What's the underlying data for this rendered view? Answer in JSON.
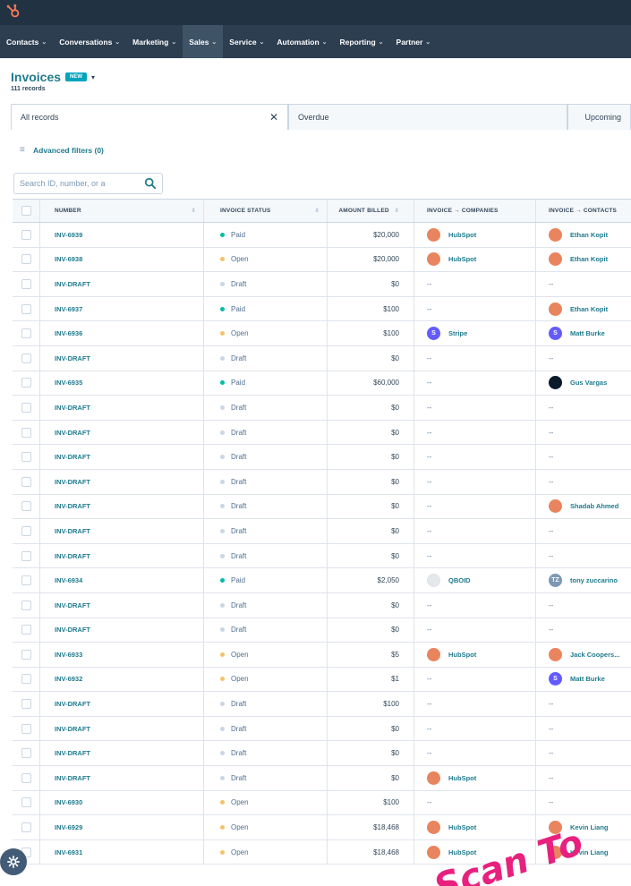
{
  "nav": {
    "items": [
      {
        "label": "Contacts",
        "active": false
      },
      {
        "label": "Conversations",
        "active": false
      },
      {
        "label": "Marketing",
        "active": false
      },
      {
        "label": "Sales",
        "active": true
      },
      {
        "label": "Service",
        "active": false
      },
      {
        "label": "Automation",
        "active": false
      },
      {
        "label": "Reporting",
        "active": false
      },
      {
        "label": "Partner",
        "active": false
      }
    ]
  },
  "header": {
    "title": "Invoices",
    "badge": "NEW",
    "count": "111 records"
  },
  "tabs": {
    "all_records": "All records",
    "overdue": "Overdue",
    "upcoming": "Upcoming"
  },
  "filters": {
    "label": "Advanced filters (0)"
  },
  "search": {
    "placeholder": "Search ID, number, or a"
  },
  "table": {
    "columns": {
      "number": "NUMBER",
      "status": "INVOICE STATUS",
      "amount": "AMOUNT BILLED",
      "companies": "INVOICE → COMPANIES",
      "contacts": "INVOICE → CONTACTS"
    },
    "rows": [
      {
        "number": "INV-6939",
        "status": "Paid",
        "amount": "$20,000",
        "company": "HubSpot",
        "contact": "Ethan Kopit"
      },
      {
        "number": "INV-6938",
        "status": "Open",
        "amount": "$20,000",
        "company": "HubSpot",
        "contact": "Ethan Kopit"
      },
      {
        "number": "INV-DRAFT",
        "status": "Draft",
        "amount": "$0",
        "company": "--",
        "contact": "--"
      },
      {
        "number": "INV-6937",
        "status": "Paid",
        "amount": "$100",
        "company": "--",
        "contact": "Ethan Kopit"
      },
      {
        "number": "INV-6936",
        "status": "Open",
        "amount": "$100",
        "company": "Stripe",
        "contact": "Matt Burke"
      },
      {
        "number": "INV-DRAFT",
        "status": "Draft",
        "amount": "$0",
        "company": "--",
        "contact": "--"
      },
      {
        "number": "INV-6935",
        "status": "Paid",
        "amount": "$60,000",
        "company": "--",
        "contact": "Gus Vargas"
      },
      {
        "number": "INV-DRAFT",
        "status": "Draft",
        "amount": "$0",
        "company": "--",
        "contact": "--"
      },
      {
        "number": "INV-DRAFT",
        "status": "Draft",
        "amount": "$0",
        "company": "--",
        "contact": "--"
      },
      {
        "number": "INV-DRAFT",
        "status": "Draft",
        "amount": "$0",
        "company": "--",
        "contact": "--"
      },
      {
        "number": "INV-DRAFT",
        "status": "Draft",
        "amount": "$0",
        "company": "--",
        "contact": "--"
      },
      {
        "number": "INV-DRAFT",
        "status": "Draft",
        "amount": "$0",
        "company": "--",
        "contact": "Shadab Ahmed"
      },
      {
        "number": "INV-DRAFT",
        "status": "Draft",
        "amount": "$0",
        "company": "--",
        "contact": "--"
      },
      {
        "number": "INV-DRAFT",
        "status": "Draft",
        "amount": "$0",
        "company": "--",
        "contact": "--"
      },
      {
        "number": "INV-6934",
        "status": "Paid",
        "amount": "$2,050",
        "company": "QBOID",
        "contact": "tony zuccarino"
      },
      {
        "number": "INV-DRAFT",
        "status": "Draft",
        "amount": "$0",
        "company": "--",
        "contact": "--"
      },
      {
        "number": "INV-DRAFT",
        "status": "Draft",
        "amount": "$0",
        "company": "--",
        "contact": "--"
      },
      {
        "number": "INV-6933",
        "status": "Open",
        "amount": "$5",
        "company": "HubSpot",
        "contact": "Jack Coopers..."
      },
      {
        "number": "INV-6932",
        "status": "Open",
        "amount": "$1",
        "company": "--",
        "contact": "Matt Burke"
      },
      {
        "number": "INV-DRAFT",
        "status": "Draft",
        "amount": "$100",
        "company": "--",
        "contact": "--"
      },
      {
        "number": "INV-DRAFT",
        "status": "Draft",
        "amount": "$0",
        "company": "--",
        "contact": "--"
      },
      {
        "number": "INV-DRAFT",
        "status": "Draft",
        "amount": "$0",
        "company": "--",
        "contact": "--"
      },
      {
        "number": "INV-DRAFT",
        "status": "Draft",
        "amount": "$0",
        "company": "HubSpot",
        "contact": "--"
      },
      {
        "number": "INV-6930",
        "status": "Open",
        "amount": "$100",
        "company": "--",
        "contact": "--"
      },
      {
        "number": "INV-6929",
        "status": "Open",
        "amount": "$18,468",
        "company": "HubSpot",
        "contact": "Kevin Liang"
      },
      {
        "number": "INV-6931",
        "status": "Open",
        "amount": "$18,468",
        "company": "HubSpot",
        "contact": "Kevin Liang"
      }
    ]
  },
  "status_colors": {
    "Paid": "#00bda5",
    "Open": "#f5c26b",
    "Draft": "#cbd6e2"
  },
  "avatar_colors": {
    "HubSpot": "#e8845e",
    "Stripe": "#635bff",
    "QBOID": "#e5e8eb",
    "Ethan Kopit": "#e8845e",
    "Matt Burke": "#635bff",
    "Gus Vargas": "#0b1a2c",
    "Shadab Ahmed": "#e8845e",
    "tony zuccarino": "#7c98b6",
    "Jack Coopers...": "#e8845e",
    "Kevin Liang": "#e8845e"
  },
  "avatar_letters": {
    "Stripe": "S",
    "Matt Burke": "S",
    "tony zuccarino": "TZ"
  },
  "watermark": {
    "text": "Scan To"
  },
  "brand_colors": {
    "accent": "#1f7b8e",
    "topbar": "#213343",
    "navbar": "#2d3e50",
    "watermark": "#e8207e"
  }
}
